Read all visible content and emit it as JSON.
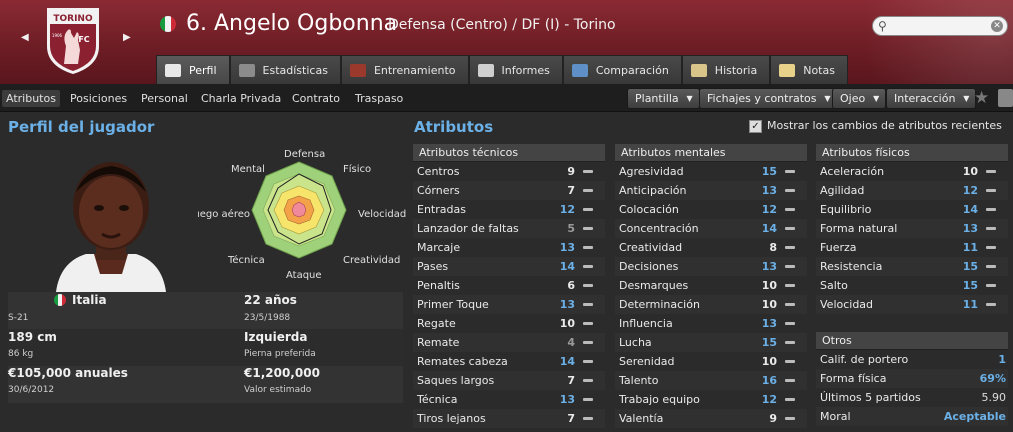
{
  "header": {
    "club_crest_text": "TORINO",
    "club_crest_fc": "FC",
    "club_crest_year": "1906",
    "player_title": "6. Angelo Ogbonna",
    "player_subtitle": "Defensa (Centro) / DF (I) - Torino",
    "search_placeholder": "",
    "icons": {
      "prev": "chevron-left-icon",
      "next": "chevron-right-icon",
      "search": "search-icon",
      "clear": "clear-icon"
    }
  },
  "tabs": [
    {
      "label": "Perfil",
      "active": true,
      "icon": "profile-icon",
      "color": "#e8e8e8"
    },
    {
      "label": "Estadísticas",
      "active": false,
      "icon": "stats-icon",
      "color": "#8b8b8b"
    },
    {
      "label": "Entrenamiento",
      "active": false,
      "icon": "training-icon",
      "color": "#9b3a2c"
    },
    {
      "label": "Informes",
      "active": false,
      "icon": "reports-icon",
      "color": "#cfcfcf"
    },
    {
      "label": "Comparación",
      "active": false,
      "icon": "comparison-icon",
      "color": "#5f8fc7"
    },
    {
      "label": "Historia",
      "active": false,
      "icon": "history-icon",
      "color": "#d9c58a"
    },
    {
      "label": "Notas",
      "active": false,
      "icon": "notes-icon",
      "color": "#e8d28a"
    }
  ],
  "subnav": [
    {
      "label": "Atributos",
      "active": true
    },
    {
      "label": "Posiciones",
      "active": false
    },
    {
      "label": "Personal",
      "active": false
    },
    {
      "label": "Charla Privada",
      "active": false
    },
    {
      "label": "Contrato",
      "active": false
    },
    {
      "label": "Traspaso",
      "active": false
    }
  ],
  "dropdowns": [
    {
      "label": "Plantilla"
    },
    {
      "label": "Fichajes y contratos"
    },
    {
      "label": "Ojeo"
    },
    {
      "label": "Interacción"
    }
  ],
  "profile": {
    "title": "Perfil del jugador",
    "radar_labels": {
      "defensa": "Defensa",
      "fisico": "Físico",
      "velocidad": "Velocidad",
      "creatividad": "Creatividad",
      "ataque": "Ataque",
      "tecnica": "Técnica",
      "juego_aereo": "Juego aéreo",
      "mental": "Mental"
    },
    "nationality": "Italia",
    "nationality_sub": "S-21",
    "age": "22 años",
    "birth_date": "23/5/1988",
    "height": "189 cm",
    "weight": "86 kg",
    "foot": "Izquierda",
    "foot_label": "Pierna preferida",
    "wage": "€105,000 anuales",
    "contract_end": "30/6/2012",
    "value": "€1,200,000",
    "value_label": "Valor estimado"
  },
  "attributes": {
    "title": "Atributos",
    "show_changes_label": "Mostrar los cambios de atributos recientes",
    "show_changes_checked": true,
    "technical": {
      "header": "Atributos técnicos",
      "rows": [
        {
          "name": "Centros",
          "value": "9"
        },
        {
          "name": "Córners",
          "value": "7"
        },
        {
          "name": "Entradas",
          "value": "12"
        },
        {
          "name": "Lanzador de faltas",
          "value": "5"
        },
        {
          "name": "Marcaje",
          "value": "13"
        },
        {
          "name": "Pases",
          "value": "14"
        },
        {
          "name": "Penaltis",
          "value": "6"
        },
        {
          "name": "Primer Toque",
          "value": "13"
        },
        {
          "name": "Regate",
          "value": "10"
        },
        {
          "name": "Remate",
          "value": "4"
        },
        {
          "name": "Remates cabeza",
          "value": "14"
        },
        {
          "name": "Saques largos",
          "value": "7"
        },
        {
          "name": "Técnica",
          "value": "13"
        },
        {
          "name": "Tiros lejanos",
          "value": "7"
        }
      ]
    },
    "mental": {
      "header": "Atributos mentales",
      "rows": [
        {
          "name": "Agresividad",
          "value": "15"
        },
        {
          "name": "Anticipación",
          "value": "13"
        },
        {
          "name": "Colocación",
          "value": "12"
        },
        {
          "name": "Concentración",
          "value": "14"
        },
        {
          "name": "Creatividad",
          "value": "8"
        },
        {
          "name": "Decisiones",
          "value": "13"
        },
        {
          "name": "Desmarques",
          "value": "10"
        },
        {
          "name": "Determinación",
          "value": "10"
        },
        {
          "name": "Influencia",
          "value": "13"
        },
        {
          "name": "Lucha",
          "value": "15"
        },
        {
          "name": "Serenidad",
          "value": "10"
        },
        {
          "name": "Talento",
          "value": "16"
        },
        {
          "name": "Trabajo equipo",
          "value": "12"
        },
        {
          "name": "Valentía",
          "value": "9"
        }
      ]
    },
    "physical": {
      "header": "Atributos físicos",
      "rows": [
        {
          "name": "Aceleración",
          "value": "10"
        },
        {
          "name": "Agilidad",
          "value": "12"
        },
        {
          "name": "Equilibrio",
          "value": "14"
        },
        {
          "name": "Forma natural",
          "value": "13"
        },
        {
          "name": "Fuerza",
          "value": "11"
        },
        {
          "name": "Resistencia",
          "value": "15"
        },
        {
          "name": "Salto",
          "value": "15"
        },
        {
          "name": "Velocidad",
          "value": "11"
        }
      ]
    },
    "others": {
      "header": "Otros",
      "rows": [
        {
          "name": "Calif. de portero",
          "value": "1"
        },
        {
          "name": "Forma física",
          "value": "69%"
        },
        {
          "name": "Últimos 5 partidos",
          "value": "5.90"
        },
        {
          "name": "Moral",
          "value": "Aceptable"
        }
      ]
    }
  },
  "colors": {
    "accent": "#6bb0e6",
    "header_bg": "#7a2330",
    "italy_green": "#169b3e",
    "italy_red": "#cf2b37"
  }
}
